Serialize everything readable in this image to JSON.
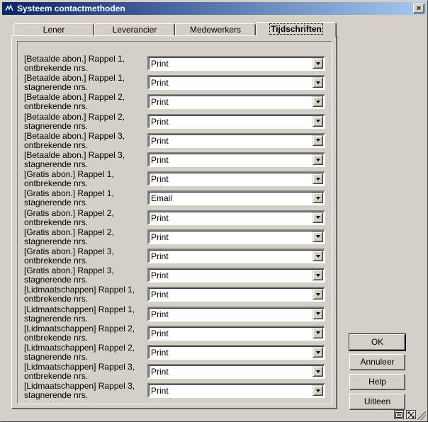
{
  "window": {
    "title": "Systeem contactmethoden",
    "close_label": "×"
  },
  "tabs": [
    {
      "label": "Lener",
      "active": false
    },
    {
      "label": "Leverancier",
      "active": false
    },
    {
      "label": "Medewerkers",
      "active": false
    },
    {
      "label": "Tijdschriften",
      "active": true
    }
  ],
  "rows": [
    {
      "label_line1": "[Betaalde abon.] Rappel 1,",
      "label_line2": "ontbrekende nrs.",
      "value": "Print"
    },
    {
      "label_line1": "[Betaalde abon.] Rappel 1,",
      "label_line2": "stagnerende nrs.",
      "value": "Print"
    },
    {
      "label_line1": "[Betaalde abon.] Rappel 2,",
      "label_line2": "ontbrekende nrs.",
      "value": "Print"
    },
    {
      "label_line1": "[Betaalde abon.] Rappel 2,",
      "label_line2": "stagnerende nrs.",
      "value": "Print"
    },
    {
      "label_line1": "[Betaalde abon.] Rappel 3,",
      "label_line2": "ontbrekende nrs.",
      "value": "Print"
    },
    {
      "label_line1": "[Betaalde abon.] Rappel 3,",
      "label_line2": "stagnerende nrs.",
      "value": "Print"
    },
    {
      "label_line1": "[Gratis abon.] Rappel 1,",
      "label_line2": "ontbrekende nrs.",
      "value": "Print"
    },
    {
      "label_line1": "[Gratis abon.] Rappel 1,",
      "label_line2": "stagnerende nrs.",
      "value": "Email"
    },
    {
      "label_line1": "[Gratis abon.] Rappel 2,",
      "label_line2": "ontbrekende nrs.",
      "value": "Print"
    },
    {
      "label_line1": "[Gratis abon.] Rappel 2,",
      "label_line2": "stagnerende nrs.",
      "value": "Print"
    },
    {
      "label_line1": "[Gratis abon.] Rappel 3,",
      "label_line2": "ontbrekende nrs.",
      "value": "Print"
    },
    {
      "label_line1": "[Gratis abon.] Rappel 3,",
      "label_line2": "stagnerende nrs.",
      "value": "Print"
    },
    {
      "label_line1": "[Lidmaatschappen] Rappel 1,",
      "label_line2": "ontbrekende nrs.",
      "value": "Print"
    },
    {
      "label_line1": "[Lidmaatschappen] Rappel 1,",
      "label_line2": "stagnerende nrs.",
      "value": "Print"
    },
    {
      "label_line1": "[Lidmaatschappen] Rappel 2,",
      "label_line2": "ontbrekende nrs.",
      "value": "Print"
    },
    {
      "label_line1": "[Lidmaatschappen] Rappel 2,",
      "label_line2": "stagnerende nrs.",
      "value": "Print"
    },
    {
      "label_line1": "[Lidmaatschappen] Rappel 3,",
      "label_line2": "ontbrekende nrs.",
      "value": "Print"
    },
    {
      "label_line1": "[Lidmaatschappen] Rappel 3,",
      "label_line2": "stagnerende nrs.",
      "value": "Print"
    }
  ],
  "buttons": {
    "ok": "OK",
    "cancel": "Annuleer",
    "help": "Help",
    "explain": "Uitleen"
  },
  "icons": {
    "title": "app-icon",
    "status_left": "keyboard-icon",
    "status_right": "resize-icon"
  }
}
